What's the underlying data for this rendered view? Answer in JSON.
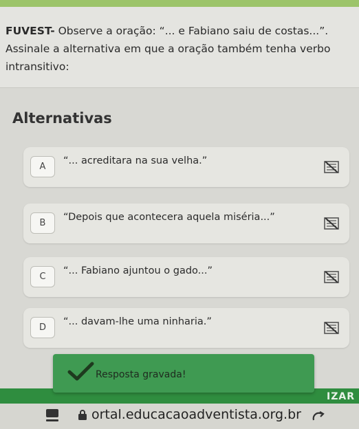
{
  "question": {
    "prefix": "FUVEST-",
    "text_line1": " Observe a oração: “... e Fabiano saiu de costas...”.",
    "text_line2": "Assinale a alternativa em que a oração também tenha verbo",
    "text_line3": "intransitivo:"
  },
  "alternatives_title": "Alternativas",
  "options": [
    {
      "letter": "A",
      "text": "“... acreditara na sua velha.”",
      "icon": "strikethrough-icon"
    },
    {
      "letter": "B",
      "text": "“Depois que acontecera aquela miséria...”",
      "icon": "strikethrough-icon"
    },
    {
      "letter": "C",
      "text": "“... Fabiano ajuntou o gado...”",
      "icon": "strikethrough-icon"
    },
    {
      "letter": "D",
      "text": "“... davam-lhe uma ninharia.”",
      "icon": "strikethrough-icon"
    }
  ],
  "toast": {
    "message": "Resposta gravada!",
    "icon": "checkmark-icon"
  },
  "finalize_label": "IZAR",
  "browser": {
    "url": "ortal.educacaoadventista.org.br"
  },
  "colors": {
    "accent_green": "#3f9a52",
    "top_bar": "#9cc46a"
  }
}
